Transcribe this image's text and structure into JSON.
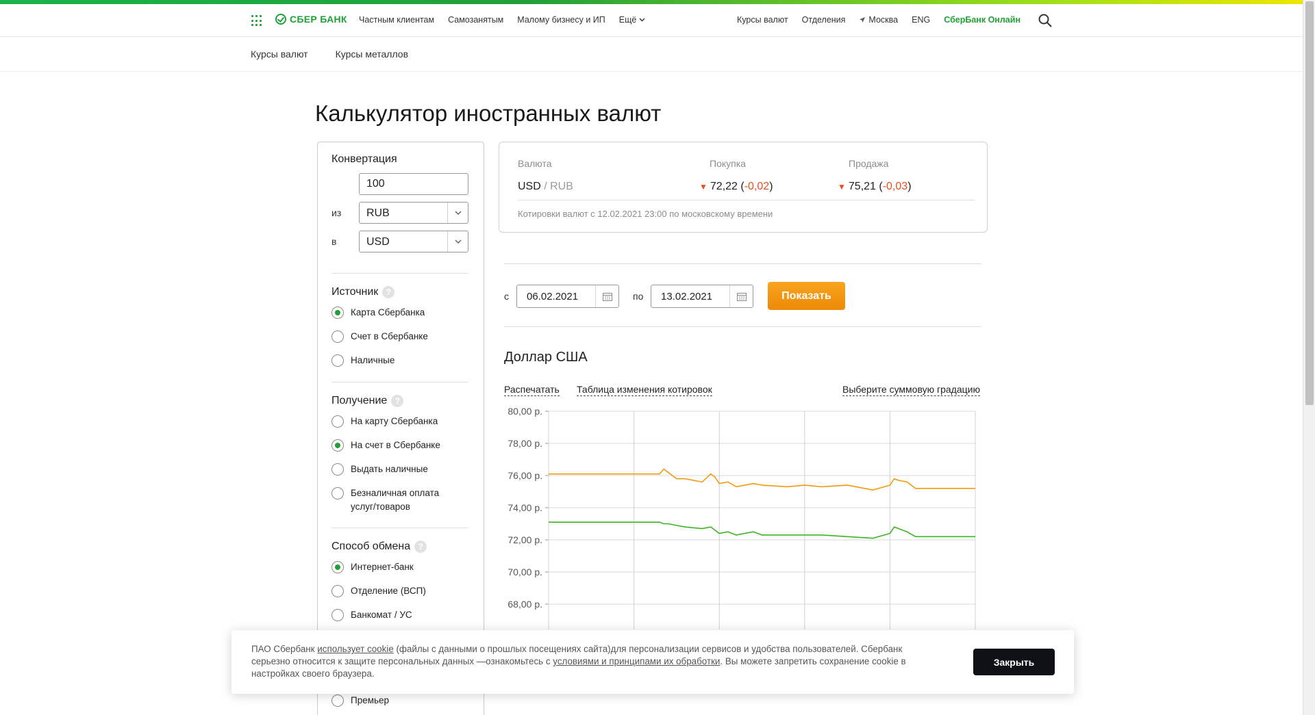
{
  "header": {
    "logo_text": "СБЕР БАНК",
    "nav_left": [
      "Частным клиентам",
      "Самозанятым",
      "Малому бизнесу и ИП",
      "Ещё"
    ],
    "nav_right": {
      "rates": "Курсы валют",
      "branches": "Отделения",
      "city": "Москва",
      "lang": "ENG",
      "online": "СберБанк Онлайн"
    }
  },
  "subnav": [
    "Курсы валют",
    "Курсы металлов"
  ],
  "page_title": "Калькулятор иностранных валют",
  "converter": {
    "title": "Конвертация",
    "amount": "100",
    "from_label": "из",
    "from_value": "RUB",
    "to_label": "в",
    "to_value": "USD"
  },
  "source": {
    "title": "Источник",
    "options": [
      {
        "label": "Карта Сбербанка",
        "selected": true
      },
      {
        "label": "Счет в Сбербанке",
        "selected": false
      },
      {
        "label": "Наличные",
        "selected": false
      }
    ]
  },
  "receive": {
    "title": "Получение",
    "options": [
      {
        "label": "На карту Сбербанка",
        "selected": false
      },
      {
        "label": "На счет в Сбербанке",
        "selected": true
      },
      {
        "label": "Выдать наличные",
        "selected": false
      },
      {
        "label": "Безналичная оплата услуг/товаров",
        "selected": false
      }
    ]
  },
  "exchange": {
    "title": "Способ обмена",
    "options": [
      {
        "label": "Интернет-банк",
        "selected": true
      },
      {
        "label": "Отделение (ВСП)",
        "selected": false
      },
      {
        "label": "Банкомат / УС",
        "selected": false
      },
      {
        "label": "Премьер",
        "selected": false
      }
    ]
  },
  "rates": {
    "col_currency": "Валюта",
    "col_buy": "Покупка",
    "col_sell": "Продажа",
    "pair_base": "USD",
    "pair_sep_quote": " / RUB",
    "buy_value": "72,22",
    "buy_change": "-0,02",
    "sell_value": "75,21",
    "sell_change": "-0,03",
    "note": "Котировки валют с 12.02.2021 23:00 по московскому времени"
  },
  "period": {
    "from_label": "с",
    "from_date": "06.02.2021",
    "to_label": "по",
    "to_date": "13.02.2021",
    "show_button": "Показать"
  },
  "chart_title": "Доллар США",
  "chart_links": {
    "print": "Распечатать",
    "table": "Таблица изменения котировок",
    "gradation": "Выберите суммовую градацию"
  },
  "colors": {
    "green": "#21a038",
    "orange": "#f29b10",
    "accent_negative": "#e8501e"
  },
  "chart_data": {
    "type": "line",
    "ylim": [
      66,
      80
    ],
    "ytick_labels": [
      "80,00 р.",
      "78,00 р.",
      "76,00 р.",
      "74,00 р.",
      "72,00 р.",
      "70,00 р.",
      "68,00 р."
    ],
    "yticks": [
      80,
      78,
      76,
      74,
      72,
      70,
      68
    ],
    "x_divisions": 5,
    "series": [
      {
        "color": "#f29b10",
        "x": [
          0,
          1,
          1.3,
          1.35,
          1.4,
          1.5,
          1.6,
          1.8,
          1.9,
          1.95,
          2.0,
          2.1,
          2.2,
          2.4,
          2.5,
          2.8,
          3.0,
          3.2,
          3.5,
          3.8,
          4.0,
          4.05,
          4.1,
          4.2,
          4.3,
          5.0
        ],
        "y": [
          76.1,
          76.1,
          76.1,
          76.4,
          76.2,
          75.8,
          75.8,
          75.6,
          76.1,
          75.9,
          75.5,
          75.6,
          75.3,
          75.5,
          75.4,
          75.3,
          75.4,
          75.3,
          75.4,
          75.1,
          75.4,
          75.8,
          75.7,
          75.6,
          75.2,
          75.2
        ]
      },
      {
        "color": "#3cb521",
        "x": [
          0,
          1,
          1.3,
          1.35,
          1.4,
          1.5,
          1.6,
          1.8,
          1.9,
          1.95,
          2.0,
          2.1,
          2.2,
          2.4,
          2.5,
          2.8,
          3.0,
          3.2,
          3.5,
          3.8,
          4.0,
          4.05,
          4.1,
          4.2,
          4.3,
          5.0
        ],
        "y": [
          73.1,
          73.1,
          73.1,
          73.0,
          73.0,
          72.9,
          72.8,
          72.7,
          72.8,
          72.6,
          72.4,
          72.5,
          72.3,
          72.5,
          72.3,
          72.3,
          72.3,
          72.3,
          72.2,
          72.1,
          72.4,
          72.8,
          72.7,
          72.5,
          72.2,
          72.2
        ]
      }
    ]
  },
  "cookie": {
    "text_1": "ПАО Сбербанк ",
    "link_1": "использует cookie",
    "text_2": " (файлы с данными о прошлых посещениях сайта)для персонализации сервисов и удобства пользователей. Сбербанк серьезно относится к защите персональных данных —ознакомьтесь с ",
    "link_2": "условиями и принципами их обработки",
    "text_3": ". Вы можете запретить сохранение cookie в настройках своего браузера.",
    "close_button": "Закрыть"
  }
}
